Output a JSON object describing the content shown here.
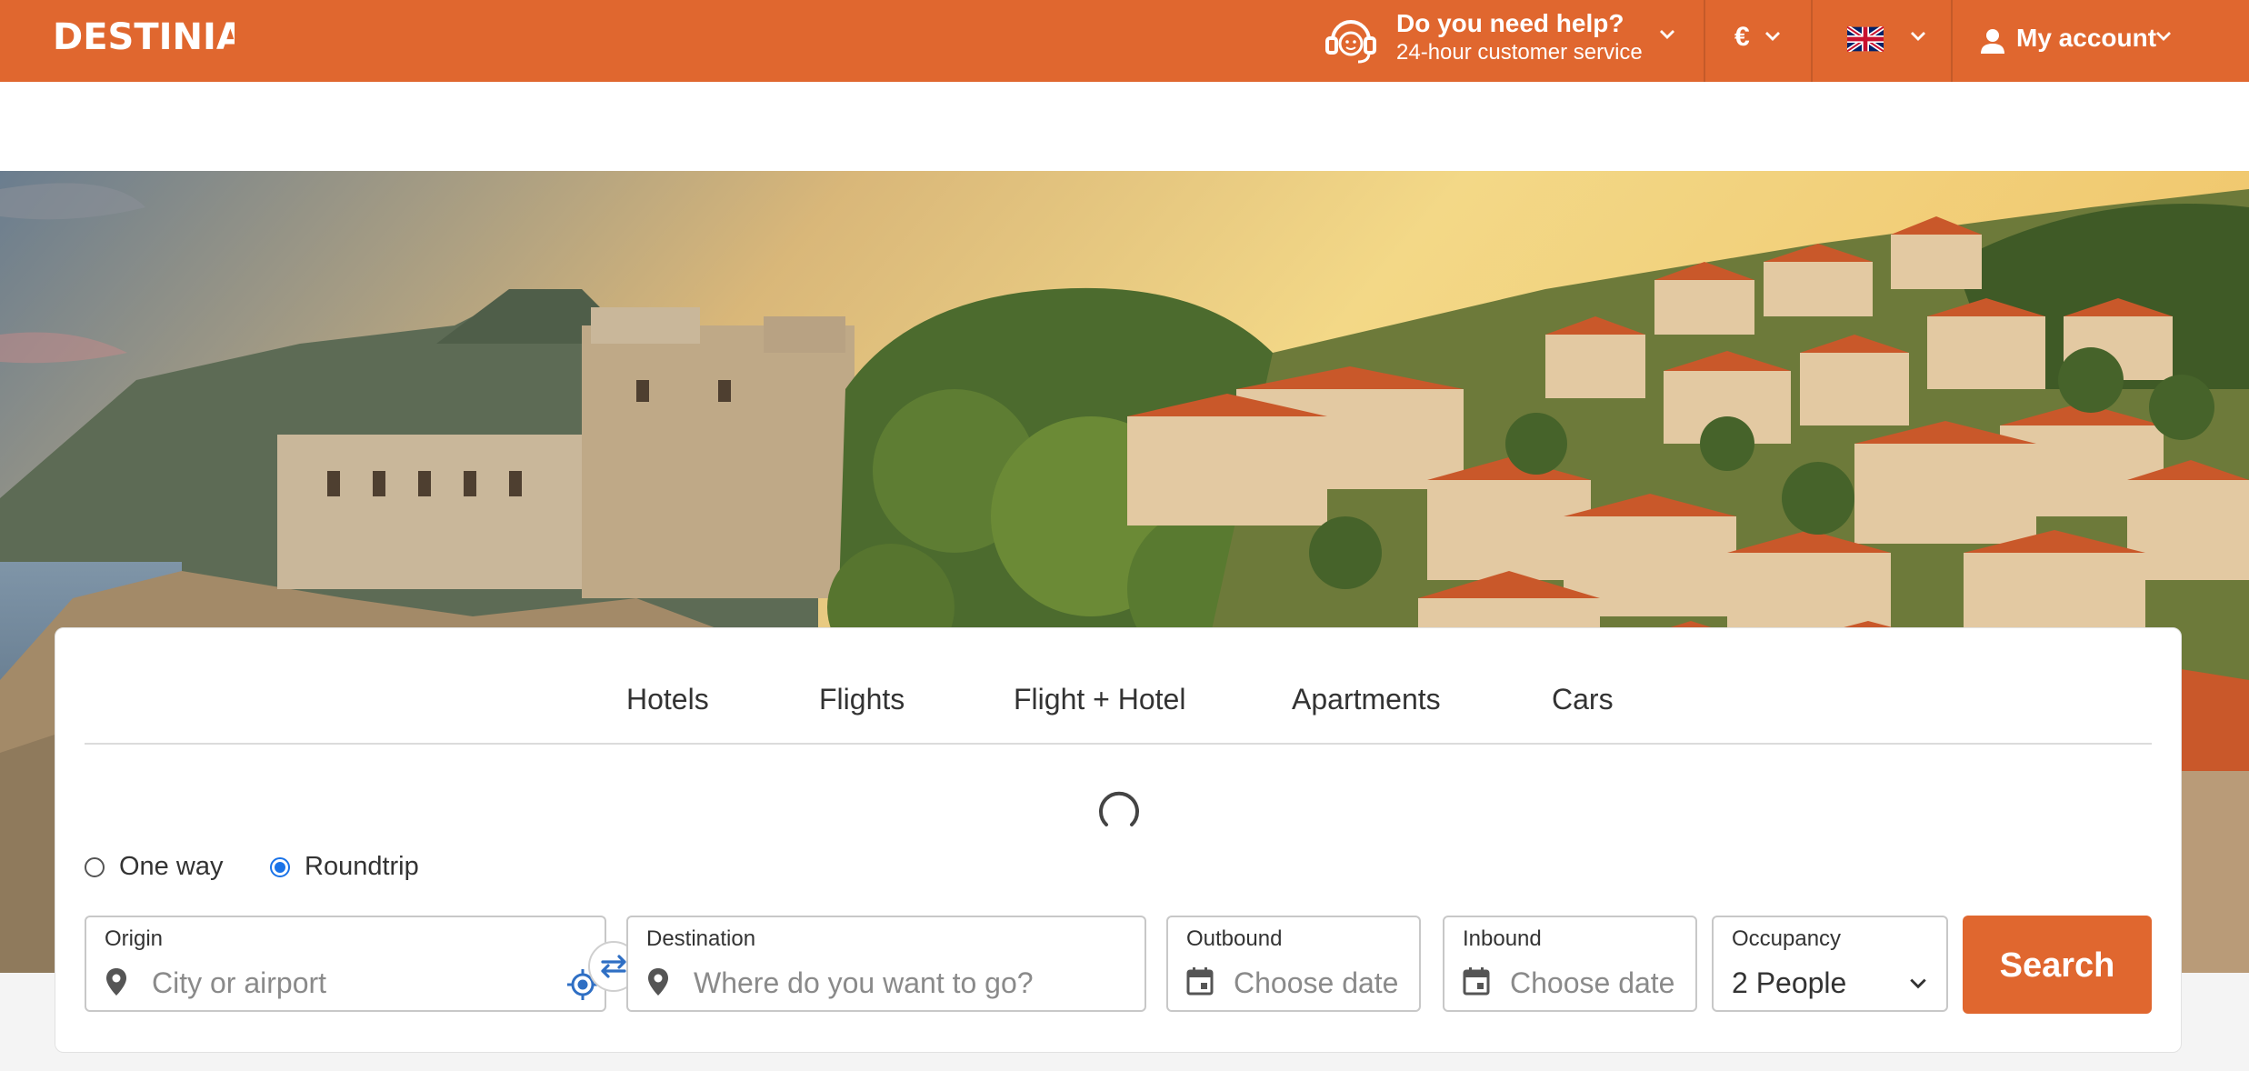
{
  "brand": {
    "logo_text": "DESTINIA",
    "accent_color": "#e0672f"
  },
  "header": {
    "help_title": "Do you need help?",
    "help_subtitle": "24-hour customer service",
    "currency": "€",
    "language_icon": "uk-flag-icon",
    "account_label": "My account"
  },
  "search": {
    "tabs": [
      {
        "label": "Hotels"
      },
      {
        "label": "Flights"
      },
      {
        "label": "Flight + Hotel"
      },
      {
        "label": "Apartments"
      },
      {
        "label": "Cars"
      }
    ],
    "trip_type": {
      "options": [
        "One way",
        "Roundtrip"
      ],
      "selected": "Roundtrip"
    },
    "origin": {
      "label": "Origin",
      "placeholder": "City or airport"
    },
    "destination": {
      "label": "Destination",
      "placeholder": "Where do you want to go?"
    },
    "outbound": {
      "label": "Outbound",
      "placeholder": "Choose date"
    },
    "inbound": {
      "label": "Inbound",
      "placeholder": "Choose date"
    },
    "occupancy": {
      "label": "Occupancy",
      "value": "2 People"
    },
    "search_button": "Search"
  }
}
